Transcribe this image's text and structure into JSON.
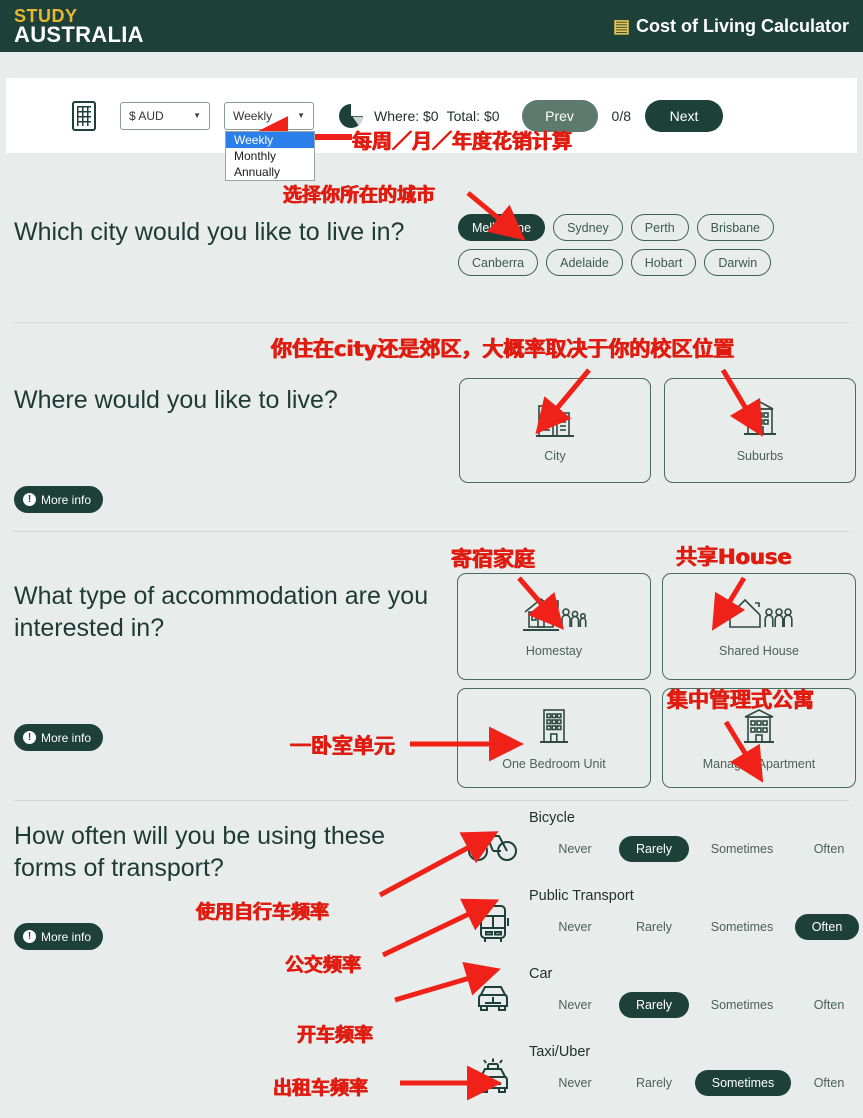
{
  "header": {
    "logo_line1": "STUDY",
    "logo_line2": "AUSTRALIA",
    "title": "Cost of Living Calculator",
    "calc_icon": "calculator-icon",
    "bg_color": "#1d4038",
    "accent_color": "#e8b833"
  },
  "toolbar": {
    "calculator_icon": "calculator-icon",
    "currency": {
      "value": "$ AUD",
      "options": [
        "$ AUD"
      ]
    },
    "period": {
      "value": "Weekly",
      "options": [
        "Weekly",
        "Monthly",
        "Annually"
      ],
      "selected_option": "Weekly",
      "expanded": true
    },
    "pie_icon": "pie-chart-icon",
    "where_total": "Where: $0   Total: $0",
    "where_label": "Where: $0",
    "total_label": "Total: $0",
    "prev_label": "Prev",
    "next_label": "Next",
    "progress": "0/8"
  },
  "sections": [
    {
      "id": "city",
      "title": "Which city would you like to live in?",
      "chips": [
        {
          "label": "Melbourne",
          "selected": true
        },
        {
          "label": "Sydney",
          "selected": false
        },
        {
          "label": "Perth",
          "selected": false
        },
        {
          "label": "Brisbane",
          "selected": false
        },
        {
          "label": "Canberra",
          "selected": false
        },
        {
          "label": "Adelaide",
          "selected": false
        },
        {
          "label": "Hobart",
          "selected": false
        },
        {
          "label": "Darwin",
          "selected": false
        }
      ]
    },
    {
      "id": "where-live",
      "title": "Where would you like to live?",
      "more_info": "More info",
      "cards": [
        {
          "label": "City",
          "icon": "city-buildings-icon"
        },
        {
          "label": "Suburbs",
          "icon": "suburb-building-icon"
        }
      ]
    },
    {
      "id": "accommodation",
      "title": "What type of accommodation are you interested in?",
      "more_info": "More info",
      "cards": [
        {
          "label": "Homestay",
          "icon": "homestay-house-family-icon"
        },
        {
          "label": "Shared House",
          "icon": "shared-house-icon"
        },
        {
          "label": "One Bedroom Unit",
          "icon": "apartment-block-icon"
        },
        {
          "label": "Managed Apartment",
          "icon": "managed-apartment-icon"
        }
      ]
    },
    {
      "id": "transport",
      "title": "How often will you be using these forms of transport?",
      "more_info": "More info",
      "options": [
        "Never",
        "Rarely",
        "Sometimes",
        "Often"
      ],
      "rows": [
        {
          "name": "Bicycle",
          "icon": "bicycle-icon",
          "selected": "Rarely"
        },
        {
          "name": "Public Transport",
          "icon": "bus-icon",
          "selected": "Often"
        },
        {
          "name": "Car",
          "icon": "car-icon",
          "selected": "Rarely"
        },
        {
          "name": "Taxi/Uber",
          "icon": "taxi-icon",
          "selected": "Sometimes"
        }
      ]
    }
  ],
  "annotations": [
    {
      "id": "a1",
      "text": "每周／月／年度花销计算"
    },
    {
      "id": "a2",
      "text": "选择你所在的城市"
    },
    {
      "id": "a3",
      "text": "你住在city还是郊区，大概率取决于你的校区位置"
    },
    {
      "id": "a4",
      "text": "寄宿家庭"
    },
    {
      "id": "a5",
      "text": "共享House"
    },
    {
      "id": "a6",
      "text": "集中管理式公寓"
    },
    {
      "id": "a7",
      "text": "一卧室单元"
    },
    {
      "id": "a8",
      "text": "使用自行车频率"
    },
    {
      "id": "a9",
      "text": "公交频率"
    },
    {
      "id": "a10",
      "text": "开车频率"
    },
    {
      "id": "a11",
      "text": "出租车频率"
    }
  ],
  "colors": {
    "brand_dark_green": "#1d4038",
    "page_bg": "#e8ecea",
    "annotation_red": "#e01b10",
    "muted_text": "#4d6159"
  }
}
